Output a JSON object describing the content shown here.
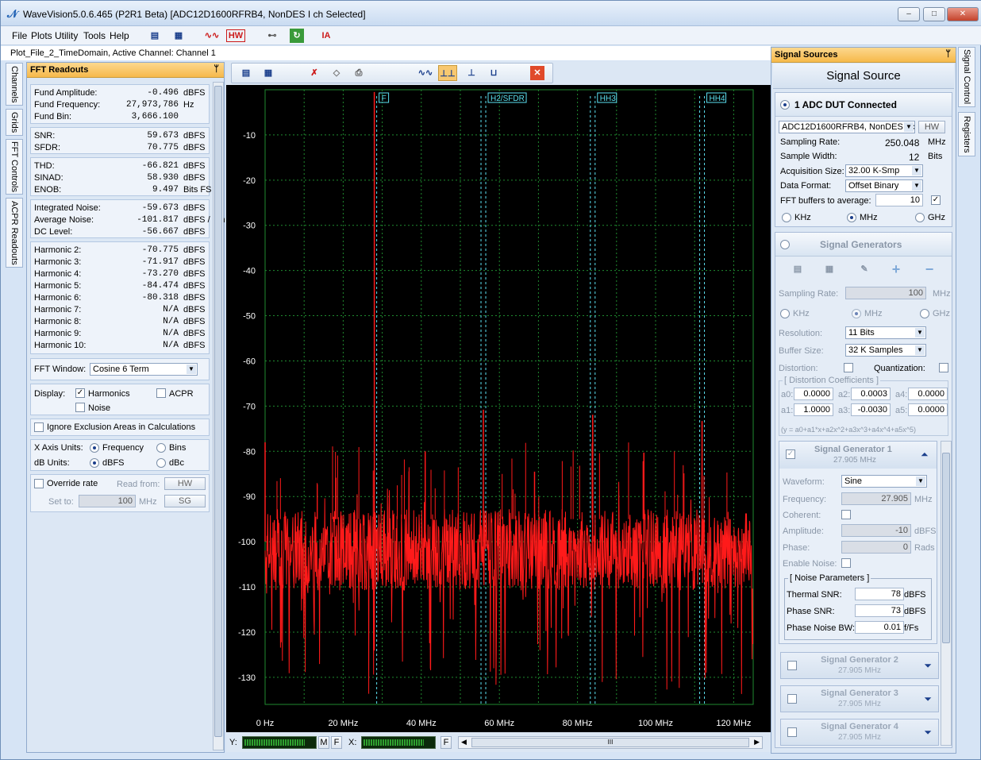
{
  "window": {
    "title": "WaveVision5.0.6.465 (P2R1 Beta)  [ADC12D1600RFRB4, NonDES I ch Selected]",
    "min": "–",
    "max": "□",
    "close": "✕"
  },
  "menu": [
    "File",
    "Plots",
    "Utility",
    "Tools",
    "Help"
  ],
  "info": "Plot_File_2_TimeDomain,  Active Channel: Channel 1",
  "left_tabs": [
    "Channels",
    "Grids",
    "FFT Controls",
    "ACPR Readouts"
  ],
  "fft": {
    "header": "FFT Readouts",
    "pin": "ᛘ",
    "fund": [
      {
        "label": "Fund Amplitude:",
        "value": "-0.496",
        "unit": "dBFS"
      },
      {
        "label": "Fund Frequency:",
        "value": "27,973,786",
        "unit": "Hz"
      },
      {
        "label": "Fund Bin:",
        "value": "3,666.100",
        "unit": ""
      }
    ],
    "noise": [
      {
        "label": "SNR:",
        "value": "59.673",
        "unit": "dBFS"
      },
      {
        "label": "SFDR:",
        "value": "70.775",
        "unit": "dBFS"
      }
    ],
    "dist": [
      {
        "label": "THD:",
        "value": "-66.821",
        "unit": "dBFS"
      },
      {
        "label": "SINAD:",
        "value": "58.930",
        "unit": "dBFS"
      },
      {
        "label": "ENOB:",
        "value": "9.497",
        "unit": "Bits FS"
      }
    ],
    "levels": [
      {
        "label": "Integrated Noise:",
        "value": "-59.673",
        "unit": "dBFS"
      },
      {
        "label": "Average Noise:",
        "value": "-101.817",
        "unit": "dBFS / Bin"
      },
      {
        "label": "DC Level:",
        "value": "-56.667",
        "unit": "dBFS"
      }
    ],
    "harmonics": [
      {
        "label": "Harmonic 2:",
        "value": "-70.775",
        "unit": "dBFS"
      },
      {
        "label": "Harmonic 3:",
        "value": "-71.917",
        "unit": "dBFS"
      },
      {
        "label": "Harmonic 4:",
        "value": "-73.270",
        "unit": "dBFS"
      },
      {
        "label": "Harmonic 5:",
        "value": "-84.474",
        "unit": "dBFS"
      },
      {
        "label": "Harmonic 6:",
        "value": "-80.318",
        "unit": "dBFS"
      },
      {
        "label": "Harmonic 7:",
        "value": "N/A",
        "unit": "dBFS"
      },
      {
        "label": "Harmonic 8:",
        "value": "N/A",
        "unit": "dBFS"
      },
      {
        "label": "Harmonic 9:",
        "value": "N/A",
        "unit": "dBFS"
      },
      {
        "label": "Harmonic 10:",
        "value": "N/A",
        "unit": "dBFS"
      }
    ],
    "window_label": "FFT Window:",
    "window_value": "Cosine 6 Term",
    "display_label": "Display:",
    "harmonics_cb": "Harmonics",
    "noise_cb": "Noise",
    "acpr_cb": "ACPR",
    "ignore_cb": "Ignore Exclusion Areas in Calculations",
    "xunits_label": "X Axis Units:",
    "xunits_freq": "Frequency",
    "xunits_bins": "Bins",
    "dbunits_label": "dB Units:",
    "dbunits_dbfs": "dBFS",
    "dbunits_dbc": "dBc",
    "override_cb": "Override rate",
    "read_from": "Read from:",
    "hw_btn": "HW",
    "set_to": "Set to:",
    "set_value": "100",
    "set_unit": "MHz",
    "sg_btn": "SG"
  },
  "plot": {
    "toolbar_close": "✕",
    "markers": [
      "F",
      "H2/SFDR",
      "HH3",
      "HH4"
    ],
    "y_label": "Y:",
    "x_label": "X:",
    "m": "M",
    "f": "F",
    "scroll_grip": "III"
  },
  "chart_data": {
    "type": "line",
    "title": "",
    "xlabel": "",
    "ylabel": "",
    "x_ticks": [
      "0 Hz",
      "20 MHz",
      "40 MHz",
      "60 MHz",
      "80 MHz",
      "100 MHz",
      "120 MHz"
    ],
    "y_ticks": [
      "-10",
      "-20",
      "-30",
      "-40",
      "-50",
      "-60",
      "-70",
      "-80",
      "-90",
      "-100",
      "-110",
      "-120",
      "-130"
    ],
    "xlim": [
      0,
      125
    ],
    "ylim": [
      -136,
      0
    ],
    "grid": true,
    "noise_floor_db": -101.8,
    "series": [
      {
        "color": "#ff1a1a",
        "values": [
          {
            "x": 0.0,
            "y": -78
          },
          {
            "x": 27.97,
            "y": -0.5
          },
          {
            "x": 55.9,
            "y": -70.8
          },
          {
            "x": 83.9,
            "y": -71.9
          },
          {
            "x": 111.9,
            "y": -73.3
          },
          {
            "x": 41.0,
            "y": -80
          },
          {
            "x": 97.0,
            "y": -80.3
          },
          {
            "x": 69.0,
            "y": -84.5
          }
        ]
      }
    ],
    "colors": {
      "background": "#000000",
      "grid": "#1f8a2f",
      "trace": "#ff1a1a",
      "marker": "#5ce0f0"
    }
  },
  "signal": {
    "header": "Signal Sources",
    "title": "Signal Source",
    "adc_radio": "1 ADC DUT Connected",
    "device": "ADC12D1600RFRB4, NonDES I ch",
    "hw": "HW",
    "sampling_rate_label": "Sampling Rate:",
    "sampling_rate": "250.048",
    "sampling_unit": "MHz",
    "sample_width_label": "Sample Width:",
    "sample_width": "12",
    "sample_width_unit": "Bits",
    "acq_label": "Acquisition Size:",
    "acq": "32.00 K-Smp",
    "format_label": "Data Format:",
    "format": "Offset Binary",
    "avg_label": "FFT buffers to average:",
    "avg": "10",
    "khz": "KHz",
    "mhz": "MHz",
    "ghz": "GHz",
    "gen_title": "Signal Generators",
    "gen_sr_label": "Sampling Rate:",
    "gen_sr": "100",
    "res_label": "Resolution:",
    "res": "11 Bits",
    "buf_label": "Buffer Size:",
    "buf": "32 K Samples",
    "dist_label": "Distortion:",
    "quant_label": "Quantization:",
    "coef_title": "[ Distortion Coefficients ]",
    "coefs": [
      {
        "l": "a0:",
        "v": "0.0000"
      },
      {
        "l": "a2:",
        "v": "0.0003"
      },
      {
        "l": "a4:",
        "v": "0.0000"
      },
      {
        "l": "a1:",
        "v": "1.0000"
      },
      {
        "l": "a3:",
        "v": "-0.0030"
      },
      {
        "l": "a5:",
        "v": "0.0000"
      }
    ],
    "formula": "(y = a0+a1*x+a2x^2+a3x^3+a4x^4+a5x^5)",
    "gen1_title": "Signal Generator 1",
    "gen1_freq": "27.905 MHz",
    "waveform_label": "Waveform:",
    "waveform": "Sine",
    "freq_label": "Frequency:",
    "freq": "27.905",
    "coherent_label": "Coherent:",
    "amp_label": "Amplitude:",
    "amp": "-10",
    "amp_unit": "dBFS",
    "phase_label": "Phase:",
    "phase": "0",
    "phase_unit": "Rads",
    "enable_noise": "Enable Noise:",
    "noise_title": "[ Noise Parameters ]",
    "thermal_label": "Thermal SNR:",
    "thermal": "78",
    "phasesnr_label": "Phase SNR:",
    "phasesnr": "73",
    "pnbw_label": "Phase Noise BW:",
    "pnbw": "0.01",
    "pnbw_unit": "f/Fs",
    "gens": [
      {
        "title": "Signal Generator 2",
        "freq": "27.905 MHz"
      },
      {
        "title": "Signal Generator 3",
        "freq": "27.905 MHz"
      },
      {
        "title": "Signal Generator 4",
        "freq": "27.905 MHz"
      }
    ]
  },
  "right_tabs": [
    "Signal Control",
    "Registers"
  ]
}
